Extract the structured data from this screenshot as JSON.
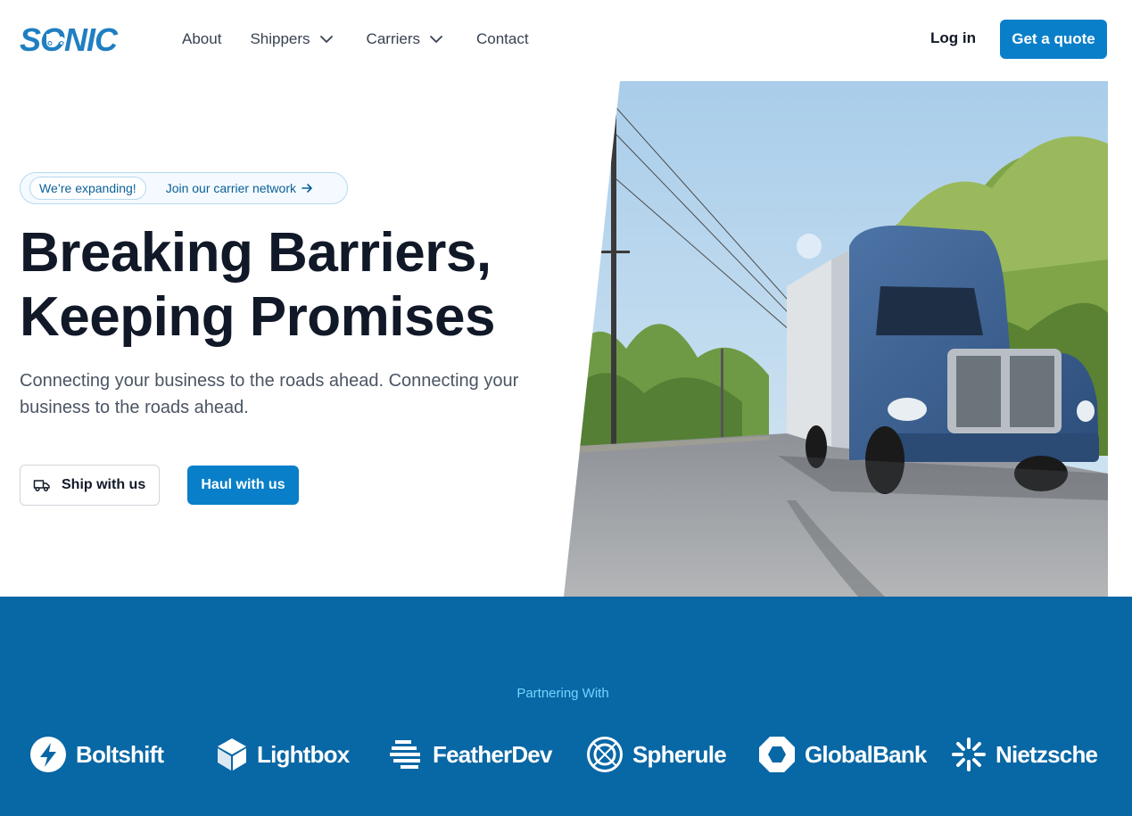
{
  "brand": {
    "name": "SONIC",
    "accent": "#0a7fc9"
  },
  "nav": {
    "about": "About",
    "shippers": "Shippers",
    "carriers": "Carriers",
    "contact": "Contact",
    "login": "Log in",
    "quote": "Get a quote"
  },
  "hero": {
    "badge": "We’re expanding!",
    "badge_link": "Join our carrier network",
    "title_line1": "Breaking Barriers,",
    "title_line2": "Keeping Promises",
    "subtitle": "Connecting your business to the roads ahead. Connecting your business to the roads ahead.",
    "ship_button": "Ship with us",
    "haul_button": "Haul with us"
  },
  "partners": {
    "label": "Partnering With",
    "band_color": "#0867a5",
    "logos": [
      {
        "name": "Boltshift",
        "icon": "bolt-icon"
      },
      {
        "name": "Lightbox",
        "icon": "cube-icon"
      },
      {
        "name": "FeatherDev",
        "icon": "feather-icon"
      },
      {
        "name": "Spherule",
        "icon": "sphere-icon"
      },
      {
        "name": "GlobalBank",
        "icon": "octagon-icon"
      },
      {
        "name": "Nietzsche",
        "icon": "burst-icon"
      }
    ]
  }
}
